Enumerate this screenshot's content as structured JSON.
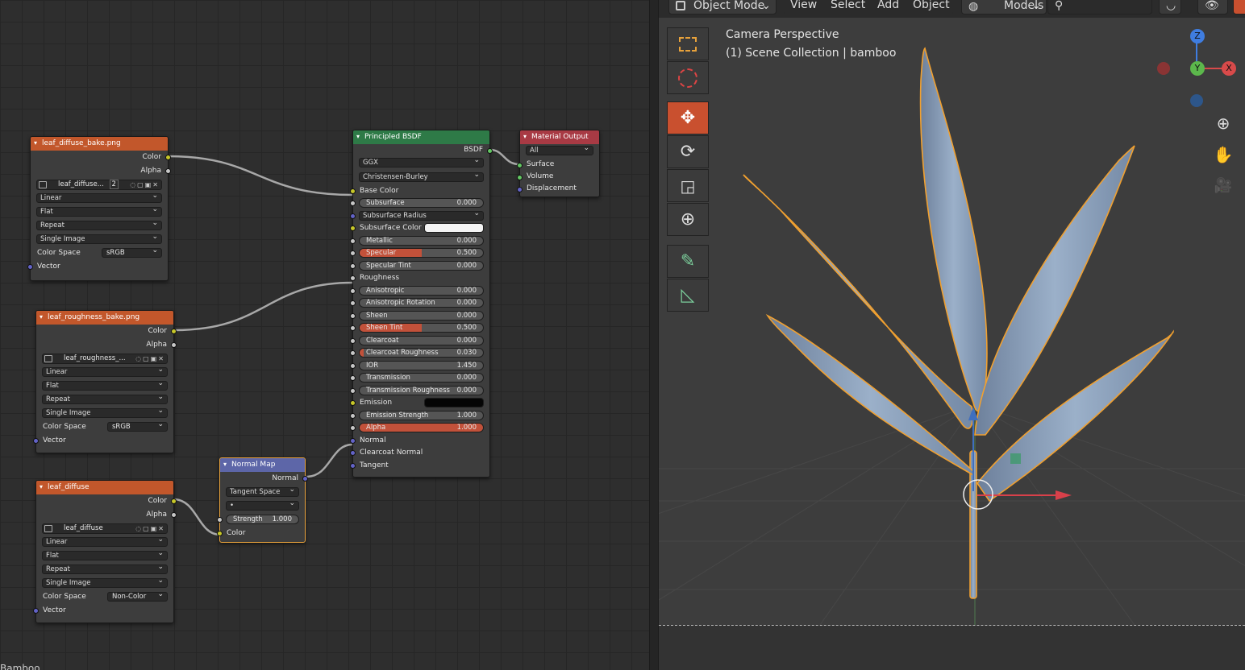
{
  "node_editor": {
    "bottom_label": "Bamboo",
    "nodes": {
      "tex1": {
        "title": "leaf_diffuse_bake.png",
        "outputs": [
          "Color",
          "Alpha"
        ],
        "image_name": "leaf_diffuse...",
        "users": "2",
        "interpolation": "Linear",
        "projection": "Flat",
        "extension": "Repeat",
        "source": "Single Image",
        "color_space_label": "Color Space",
        "color_space": "sRGB",
        "input": "Vector"
      },
      "tex2": {
        "title": "leaf_roughness_bake.png",
        "outputs": [
          "Color",
          "Alpha"
        ],
        "image_name": "leaf_roughness_...",
        "interpolation": "Linear",
        "projection": "Flat",
        "extension": "Repeat",
        "source": "Single Image",
        "color_space_label": "Color Space",
        "color_space": "sRGB",
        "input": "Vector"
      },
      "tex3": {
        "title": "leaf_diffuse",
        "outputs": [
          "Color",
          "Alpha"
        ],
        "image_name": "leaf_diffuse",
        "interpolation": "Linear",
        "projection": "Flat",
        "extension": "Repeat",
        "source": "Single Image",
        "color_space_label": "Color Space",
        "color_space": "Non-Color",
        "input": "Vector"
      },
      "normal_map": {
        "title": "Normal Map",
        "output": "Normal",
        "space": "Tangent Space",
        "uv": "•",
        "strength_label": "Strength",
        "strength": "1.000",
        "input": "Color"
      },
      "bsdf": {
        "title": "Principled BSDF",
        "output": "BSDF",
        "distribution": "GGX",
        "subsurface_method": "Christensen-Burley",
        "base_color": "Base Color",
        "subsurface": {
          "label": "Subsurface",
          "value": "0.000",
          "fill": 0
        },
        "subsurface_radius": "Subsurface Radius",
        "subsurface_color": "Subsurface Color",
        "metallic": {
          "label": "Metallic",
          "value": "0.000",
          "fill": 0
        },
        "specular": {
          "label": "Specular",
          "value": "0.500",
          "fill": 0.5
        },
        "specular_tint": {
          "label": "Specular Tint",
          "value": "0.000",
          "fill": 0
        },
        "roughness": "Roughness",
        "anisotropic": {
          "label": "Anisotropic",
          "value": "0.000",
          "fill": 0
        },
        "anisotropic_rotation": {
          "label": "Anisotropic Rotation",
          "value": "0.000",
          "fill": 0
        },
        "sheen": {
          "label": "Sheen",
          "value": "0.000",
          "fill": 0
        },
        "sheen_tint": {
          "label": "Sheen Tint",
          "value": "0.500",
          "fill": 0.5
        },
        "clearcoat": {
          "label": "Clearcoat",
          "value": "0.000",
          "fill": 0
        },
        "clearcoat_roughness": {
          "label": "Clearcoat Roughness",
          "value": "0.030",
          "fill": 0.03
        },
        "ior": {
          "label": "IOR",
          "value": "1.450"
        },
        "transmission": {
          "label": "Transmission",
          "value": "0.000",
          "fill": 0
        },
        "transmission_roughness": {
          "label": "Transmission Roughness",
          "value": "0.000",
          "fill": 0
        },
        "emission": "Emission",
        "emission_strength": {
          "label": "Emission Strength",
          "value": "1.000"
        },
        "alpha": {
          "label": "Alpha",
          "value": "1.000",
          "fill": 1
        },
        "normal": "Normal",
        "clearcoat_normal": "Clearcoat Normal",
        "tangent": "Tangent"
      },
      "output": {
        "title": "Material Output",
        "target": "All",
        "inputs": [
          "Surface",
          "Volume",
          "Displacement"
        ]
      }
    }
  },
  "viewport": {
    "mode": "Object Mode",
    "menus": [
      "View",
      "Select",
      "Add",
      "Object"
    ],
    "collection": "Models",
    "camera_label": "Camera Perspective",
    "scene_label": "(1) Scene Collection | bamboo",
    "gizmo": {
      "z": "Z",
      "y": "Y",
      "x": "X"
    },
    "tools": [
      "select-box-icon",
      "cursor-icon",
      "move-icon",
      "rotate-icon",
      "scale-icon",
      "transform-icon",
      "annotate-icon",
      "measure-icon"
    ],
    "nav": [
      "zoom-icon",
      "pan-hand-icon",
      "camera-icon"
    ]
  },
  "colors": {
    "texture_header": "#c2572b",
    "shader_header": "#2e7a47",
    "output_header": "#a83a44",
    "vector_header": "#5d66a8",
    "active_tool": "#c9502f",
    "selection_outline": "#e8a23b",
    "leaf": "#7f93ad"
  }
}
